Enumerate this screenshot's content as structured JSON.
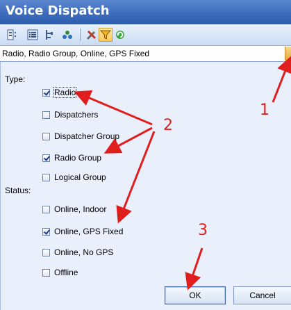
{
  "window": {
    "title": "Voice Dispatch"
  },
  "toolbar": {
    "buttons": [
      {
        "icon": "tree-view-icon"
      },
      {
        "icon": "list-view-icon"
      },
      {
        "icon": "hierarchy-icon"
      },
      {
        "icon": "groups-icon"
      },
      {
        "icon": "tools-icon"
      },
      {
        "icon": "filter-icon",
        "active": true
      },
      {
        "icon": "refresh-icon"
      }
    ]
  },
  "filter": {
    "value": "Radio, Radio Group, Online, GPS Fixed"
  },
  "type_section": {
    "label": "Type:",
    "options": [
      {
        "label": "Radio",
        "checked": true
      },
      {
        "label": "Dispatchers",
        "checked": false
      },
      {
        "label": "Dispatcher Group",
        "checked": false
      },
      {
        "label": "Radio Group",
        "checked": true
      },
      {
        "label": "Logical Group",
        "checked": false
      }
    ]
  },
  "status_section": {
    "label": "Status:",
    "options": [
      {
        "label": "Online, Indoor",
        "checked": false
      },
      {
        "label": "Online, GPS Fixed",
        "checked": true
      },
      {
        "label": "Online, No GPS",
        "checked": false
      },
      {
        "label": "Offline",
        "checked": false
      }
    ]
  },
  "buttons": {
    "ok": "OK",
    "cancel": "Cancel"
  },
  "annotations": {
    "n1": "1",
    "n2": "2",
    "n3": "3",
    "color": "#e01e1e"
  }
}
